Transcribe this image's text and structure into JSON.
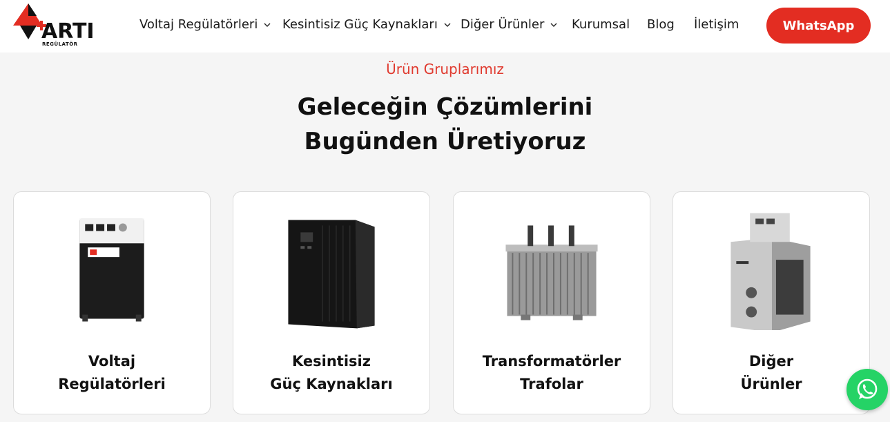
{
  "header": {
    "logo_text": "ARTI",
    "logo_sub": "REGÜLATÖR",
    "nav": [
      {
        "label": "Voltaj Regülatörleri",
        "has_dropdown": true
      },
      {
        "label": "Kesintisiz Güç Kaynakları",
        "has_dropdown": true
      },
      {
        "label": "Diğer Ürünler",
        "has_dropdown": true
      },
      {
        "label": "Kurumsal",
        "has_dropdown": false
      },
      {
        "label": "Blog",
        "has_dropdown": false
      },
      {
        "label": "İletişim",
        "has_dropdown": false
      }
    ],
    "whatsapp_label": "WhatsApp"
  },
  "section": {
    "eyebrow": "Ürün Gruplarımız",
    "headline_line1": "Geleceğin Çözümlerini",
    "headline_line2": "Bugünden Üretiyoruz"
  },
  "cards": [
    {
      "line1": "Voltaj",
      "line2": "Regülatörleri",
      "icon": "voltage-regulator-image"
    },
    {
      "line1": "Kesintisiz",
      "line2": "Güç Kaynakları",
      "icon": "ups-image"
    },
    {
      "line1": "Transformatörler",
      "line2": "Trafolar",
      "icon": "transformer-image"
    },
    {
      "line1": "Diğer",
      "line2": "Ürünler",
      "icon": "other-products-image"
    }
  ],
  "colors": {
    "accent": "#e32d22",
    "eyebrow": "#e03a2f",
    "whatsapp_green": "#25d366",
    "background": "#f5f5f5"
  }
}
